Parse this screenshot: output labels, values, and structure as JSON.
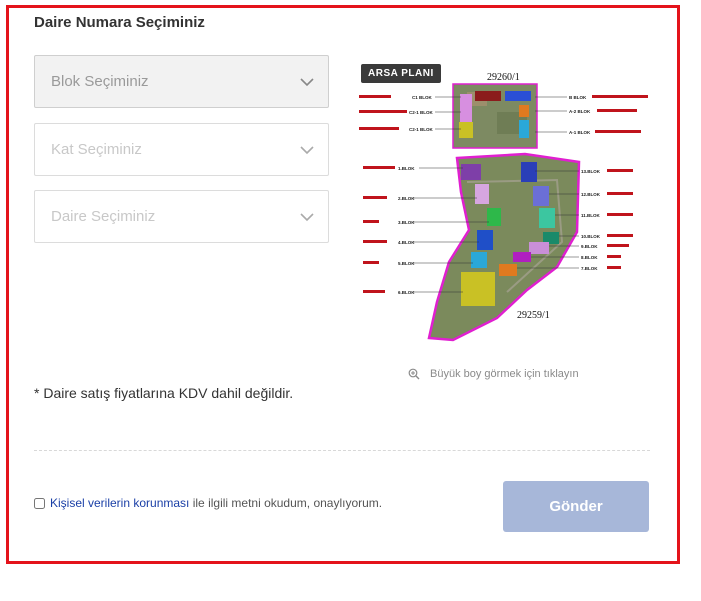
{
  "form": {
    "title": "Daire Numara Seçiminiz",
    "selects": [
      {
        "label": "Blok Seçiminiz"
      },
      {
        "label": "Kat Seçiminiz"
      },
      {
        "label": "Daire Seçiminiz"
      }
    ],
    "note": "* Daire satış fiyatlarına KDV dahil değildir.",
    "consent_link": "Kişisel verilerin korunması",
    "consent_text": " ile ilgili metni okudum, onaylıyorum.",
    "submit_label": "Gönder"
  },
  "plan": {
    "badge": "ARSA PLANI",
    "parcel_top": "29260/1",
    "parcel_bottom": "29259/1",
    "zoom_text": "Büyük boy görmek için tıklayın",
    "blocks_left_top": [
      "C1 BLOK",
      "C2-1 BLOK",
      "C2-1 BLOK"
    ],
    "blocks_right_top": [
      "B BLOK",
      "A-2 BLOK",
      "A-1 BLOK"
    ],
    "blocks_left": [
      "1.BLOK",
      "2.BLOK",
      "3.BLOK",
      "4.BLOK",
      "5.BLOK",
      "6.BLOK"
    ],
    "blocks_right": [
      "13.BLOK",
      "12.BLOK",
      "11.BLOK",
      "10.BLOK",
      "9.BLOK",
      "8.BLOK",
      "7.BLOK"
    ],
    "colors": {
      "boundary": "#e01fd0",
      "label_red": "#c0141c",
      "leader": "#333333"
    }
  }
}
